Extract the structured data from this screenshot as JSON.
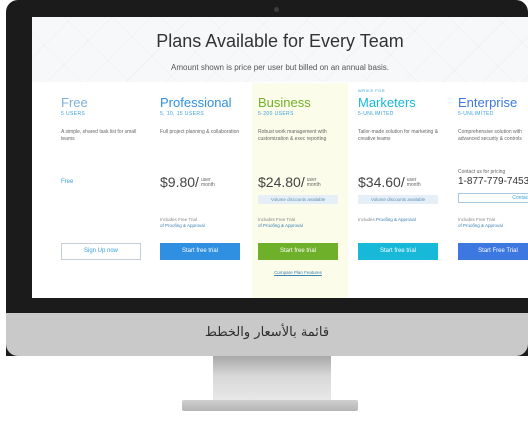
{
  "header": {
    "title": "Plans Available for Every Team",
    "subtitle": "Amount shown is price per user but billed on an annual basis."
  },
  "plans": [
    {
      "name": "Free",
      "users": "5 USERS",
      "description": "A simple, shared task list for small teams",
      "price_text": "Free",
      "button": "Sign Up now"
    },
    {
      "name": "Professional",
      "users": "5, 10, 15 USERS",
      "description": "Full project planning & collaboration",
      "price": "$9.80/",
      "price_unit_top": "user",
      "price_unit_bottom": "month",
      "trial_line1": "Includes Free Trial",
      "trial_line2": "of Proofing & Approval",
      "button": "Start free trial"
    },
    {
      "name": "Business",
      "users": "5-200 USERS",
      "description": "Robust work management with customization & exec reporting",
      "price": "$24.80/",
      "price_unit_top": "user",
      "price_unit_bottom": "month",
      "volume": "Volume discounts available",
      "trial_line1": "Includes Free Trial",
      "trial_line2": "of Proofing & Approval",
      "button": "Start free trial",
      "compare": "Compare Plan Features"
    },
    {
      "name": "Marketers",
      "tag": "WRIKE FOR",
      "users": "5-UNLIMITED",
      "description": "Tailor-made solution for marketing & creative teams",
      "price": "$34.60/",
      "price_unit_top": "user",
      "price_unit_bottom": "month",
      "volume": "Volume discounts available",
      "trial_line1": "Includes",
      "trial_line2": "Proofing & Approval",
      "button": "Start free trial"
    },
    {
      "name": "Enterprise",
      "users": "5-UNLIMITED",
      "description": "Comprehensive solution with advanced security & controls",
      "contact": "Contact us for pricing",
      "phone": "1-877-779-7453",
      "contact_button": "Contact Us",
      "trial_line1": "Includes Free Trial",
      "trial_line2": "of Proofing & Approval",
      "button": "Start Free Trial"
    }
  ],
  "caption": "قائمة بالأسعار والخطط",
  "colors": {
    "free": "#7fb0d4",
    "professional": "#2f8fe0",
    "business": "#6fb02a",
    "marketers": "#17b8d8",
    "enterprise": "#3d78e0"
  }
}
